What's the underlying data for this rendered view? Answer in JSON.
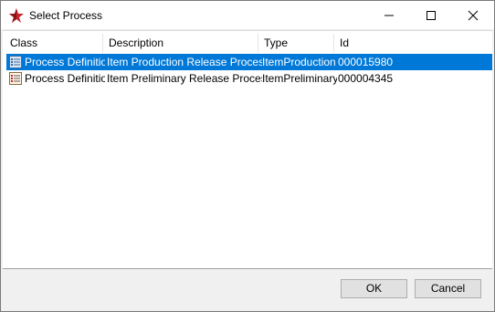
{
  "window": {
    "title": "Select Process"
  },
  "columns": [
    "Class",
    "Description",
    "Type",
    "Id"
  ],
  "rows": [
    {
      "class": "Process Definition",
      "description": "Item Production Release Process",
      "type": "ItemProduction",
      "id": "000015980",
      "icon": "process-definition-icon",
      "selected": true
    },
    {
      "class": "Process Definition",
      "description": "Item Preliminary Release Process",
      "type": "ItemPreliminary",
      "id": "000004345",
      "icon": "process-definition-icon",
      "selected": false
    }
  ],
  "buttons": {
    "ok": "OK",
    "cancel": "Cancel"
  },
  "colors": {
    "selection": "#0078d7",
    "accent_icon": "#c8232c"
  }
}
